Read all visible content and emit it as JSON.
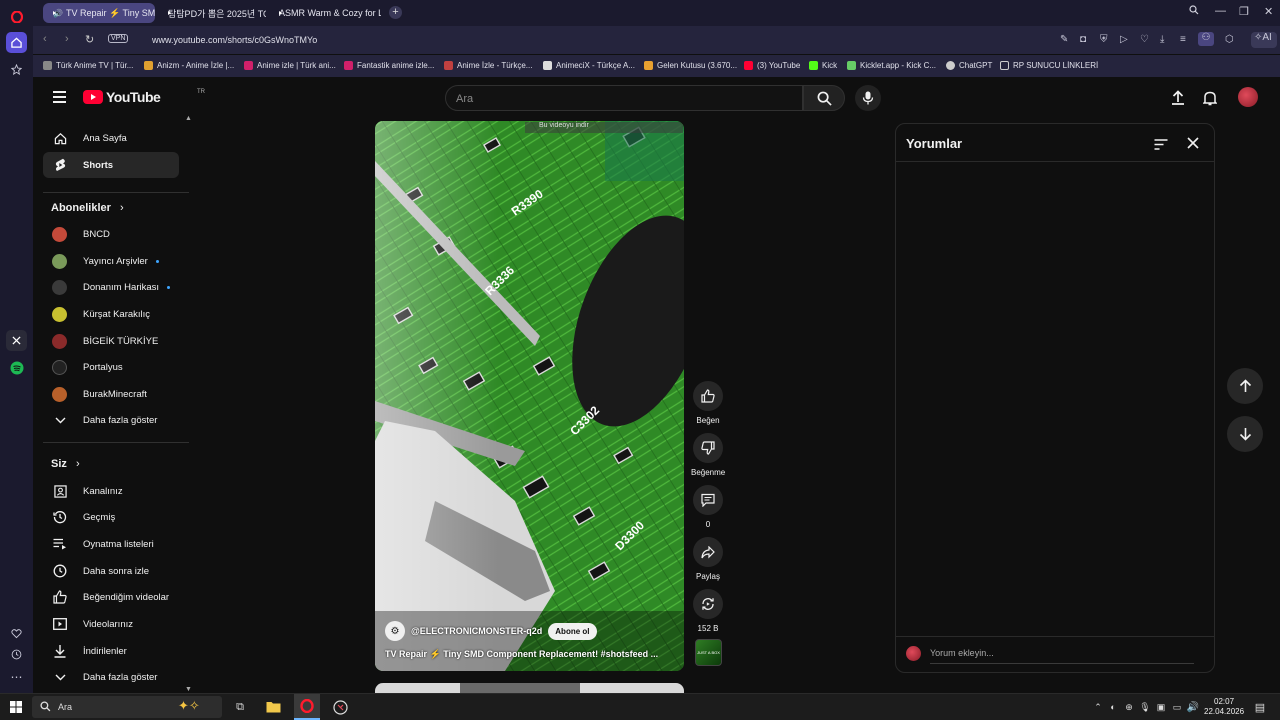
{
  "browser": {
    "tabs": [
      {
        "label": "TV Repair ⚡ Tiny SM",
        "active": true
      },
      {
        "label": "탐탐PD가 뽑은 2025년 TO",
        "active": false
      },
      {
        "label": "ASMR Warm & Cozy for L",
        "active": false
      }
    ],
    "url": "www.youtube.com/shorts/c0GsWnoTMYo",
    "vpn_label": "VPN",
    "ai_label": "AI",
    "bookmarks": [
      "Türk Anime TV | Tür...",
      "Anizm - Anime İzle |...",
      "Anime izle | Türk ani...",
      "Fantastik anime izle...",
      "Anime İzle - Türkçe...",
      "AnimeciX - Türkçe A...",
      "Gelen Kutusu (3.670...",
      "(3) YouTube",
      "Kick",
      "Kicklet.app - Kick C...",
      "ChatGPT",
      "RP SUNUCU LİNKLERİ"
    ]
  },
  "youtube": {
    "logo_text": "YouTube",
    "logo_region": "TR",
    "search_placeholder": "Ara",
    "sidebar": {
      "main": [
        {
          "label": "Ana Sayfa",
          "icon": "home-icon"
        },
        {
          "label": "Shorts",
          "icon": "shorts-icon"
        }
      ],
      "subscriptions_header": "Abonelikler",
      "subscriptions": [
        {
          "label": "BNCD",
          "live": false,
          "color": "#c44a3a"
        },
        {
          "label": "Yayıncı Arşivler",
          "live": true,
          "color": "#7a9a5a"
        },
        {
          "label": "Donanım Harikası",
          "live": true,
          "color": "#3a3a3a"
        },
        {
          "label": "Kürşat Karakılıç",
          "live": false,
          "color": "#c8c030"
        },
        {
          "label": "BİGEİK TÜRKİYE",
          "live": false,
          "color": "#8a2a2a"
        },
        {
          "label": "Portalyus",
          "live": false,
          "color": "#222222"
        },
        {
          "label": "BurakMinecraft",
          "live": false,
          "color": "#b8602a"
        }
      ],
      "show_more": "Daha fazla göster",
      "you_header": "Siz",
      "you_items": [
        {
          "label": "Kanalınız",
          "icon": "account-box-icon"
        },
        {
          "label": "Geçmiş",
          "icon": "history-icon"
        },
        {
          "label": "Oynatma listeleri",
          "icon": "playlist-icon"
        },
        {
          "label": "Daha sonra izle",
          "icon": "clock-icon"
        },
        {
          "label": "Beğendiğim videolar",
          "icon": "thumbs-up-icon"
        },
        {
          "label": "Videolarınız",
          "icon": "video-icon"
        },
        {
          "label": "İndirilenler",
          "icon": "download-icon"
        },
        {
          "label": "Daha fazla göster",
          "icon": "chevron-down-icon"
        }
      ]
    },
    "short": {
      "channel": "@ELECTRONICMONSTER-q2d",
      "subscribe_label": "Abone ol",
      "title_prefix": "TV Repair ⚡ Tiny SMD Component Replacement! ",
      "title_hashtag": "#shotsfeed ...",
      "download_banner": "Bu videoyu indir",
      "board_labels": [
        "R3390",
        "R3336",
        "C3302",
        "D3300"
      ]
    },
    "actions": {
      "like": "Beğen",
      "dislike": "Beğenme",
      "comments_count": "0",
      "share": "Paylaş",
      "remix_count": "152 B",
      "thumb_text": "JUST A BOX"
    },
    "comments_panel": {
      "title": "Yorumlar",
      "input_placeholder": "Yorum ekleyin..."
    }
  },
  "taskbar": {
    "search": "Ara",
    "time": "02:07",
    "date": "22.04.2026"
  }
}
